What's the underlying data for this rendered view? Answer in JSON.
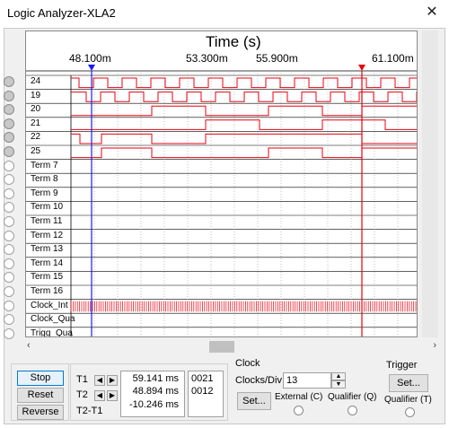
{
  "window": {
    "title": "Logic Analyzer-XLA2",
    "close_glyph": "✕"
  },
  "plot": {
    "axis_title": "Time (s)",
    "ticks": [
      "48.100m",
      "53.300m",
      "55.900m",
      "61.100m"
    ]
  },
  "channels": [
    {
      "label": "24",
      "active": true
    },
    {
      "label": "19",
      "active": true
    },
    {
      "label": "20",
      "active": true
    },
    {
      "label": "21",
      "active": true
    },
    {
      "label": "22",
      "active": true
    },
    {
      "label": "25",
      "active": true
    },
    {
      "label": "Term 7",
      "active": false
    },
    {
      "label": "Term 8",
      "active": false
    },
    {
      "label": "Term 9",
      "active": false
    },
    {
      "label": "Term 10",
      "active": false
    },
    {
      "label": "Term 11",
      "active": false
    },
    {
      "label": "Term 12",
      "active": false
    },
    {
      "label": "Term 13",
      "active": false
    },
    {
      "label": "Term 14",
      "active": false
    },
    {
      "label": "Term 15",
      "active": false
    },
    {
      "label": "Term 16",
      "active": false
    },
    {
      "label": "Clock_Int",
      "active": false
    },
    {
      "label": "Clock_Qua",
      "active": false
    },
    {
      "label": "Trigg_Qua",
      "active": false
    }
  ],
  "controls": {
    "stop": "Stop",
    "reset": "Reset",
    "reverse": "Reverse"
  },
  "cursors": {
    "t1_label": "T1",
    "t2_label": "T2",
    "diff_label": "T2-T1",
    "t1_value": "59.141 ms",
    "t2_value": "48.894 ms",
    "diff_value": "-10.246 ms",
    "t1_code": "0021",
    "t2_code": "0012"
  },
  "clock": {
    "group_label": "Clock",
    "clocks_div_label": "Clocks/Div",
    "clocks_div_value": "13",
    "set_label": "Set...",
    "external_label": "External (C)",
    "qualifier_label": "Qualifier (Q)"
  },
  "trigger": {
    "group_label": "Trigger",
    "set_label": "Set...",
    "qualifier_label": "Qualifier (T)"
  },
  "colors": {
    "signal": "#e8000f",
    "cursor_t1": "#1a1aff",
    "cursor_t2": "#e8000f"
  }
}
